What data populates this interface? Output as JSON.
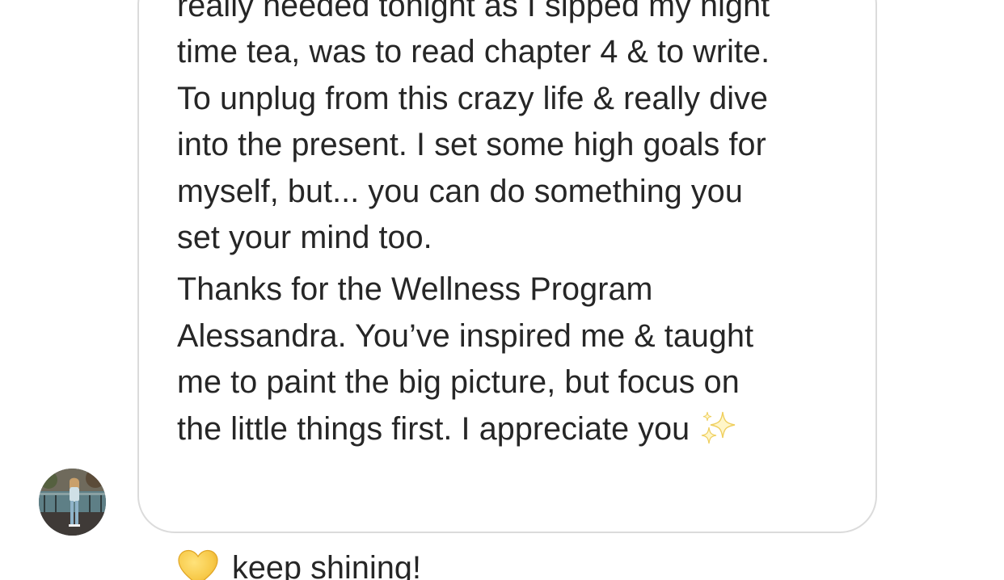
{
  "conversation": {
    "message": {
      "paragraph_1": "really needed tonight as I sipped my night\ntime tea, was to read chapter 4 & to write.\nTo unplug from this crazy life & really dive\ninto the present. I set some high goals for\nmyself, but... you can do something you\nset your mind too.",
      "paragraph_2": "Thanks for the Wellness Program\nAlessandra. You’ve inspired me & taught\nme to paint the big picture, but focus on\nthe little things first. I appreciate you",
      "closing_text": "keep shining!",
      "emoji": {
        "sparkles": "sparkles-emoji",
        "heart": "yellow-heart-emoji"
      }
    },
    "sender": {
      "avatar_icon": "profile-photo"
    },
    "colors": {
      "text": "#262626",
      "bubble_border": "#dbdbdb",
      "background": "#ffffff",
      "heart": "#f7c948",
      "sparkle": "#f3d36b"
    }
  }
}
